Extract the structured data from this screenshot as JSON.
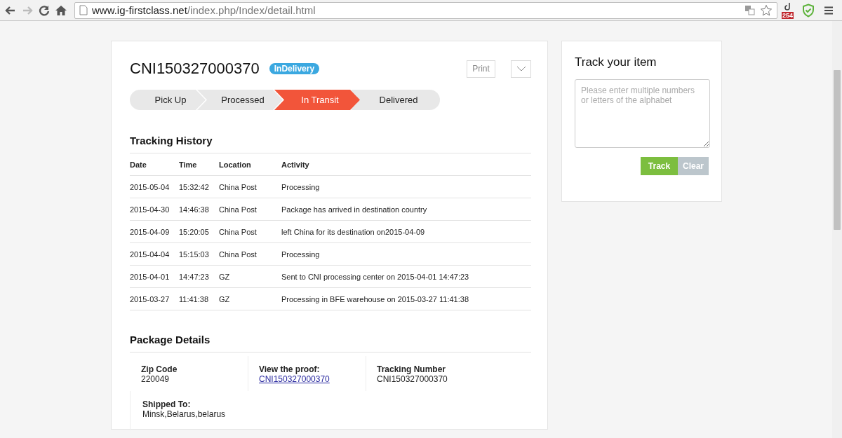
{
  "browser": {
    "url_host": "www.ig-firstclass.net",
    "url_path": "/index.php/Index/detail.html",
    "extension_badge": "254"
  },
  "shipment": {
    "number": "CNI150327000370",
    "status_badge": "InDelivery",
    "print_button": "Print"
  },
  "steps": [
    {
      "label": "Pick Up",
      "selected": false
    },
    {
      "label": "Processed",
      "selected": false
    },
    {
      "label": "In Transit",
      "selected": true
    },
    {
      "label": "Delivered",
      "selected": false
    }
  ],
  "tracking_history": {
    "title": "Tracking History",
    "columns": [
      "Date",
      "Time",
      "Location",
      "Activity"
    ],
    "rows": [
      [
        "2015-05-04",
        "15:32:42",
        "China Post",
        "Processing"
      ],
      [
        "2015-04-30",
        "14:46:38",
        "China Post",
        "Package has arrived in destination country"
      ],
      [
        "2015-04-09",
        "15:20:05",
        "China Post",
        "left China for its destination on2015-04-09"
      ],
      [
        "2015-04-04",
        "15:15:03",
        "China Post",
        "Processing"
      ],
      [
        "2015-04-01",
        "14:47:23",
        "GZ",
        "Sent to CNI processing center on 2015-04-01 14:47:23"
      ],
      [
        "2015-03-27",
        "11:41:38",
        "GZ",
        "Processing in BFE warehouse on 2015-03-27 11:41:38"
      ]
    ]
  },
  "package_details": {
    "title": "Package Details",
    "fields": [
      {
        "label": "Zip Code",
        "value": "220049",
        "kind": "text"
      },
      {
        "label": "View the proof:",
        "value": "CNI150327000370",
        "kind": "link"
      },
      {
        "label": "Tracking Number",
        "value": "CNI150327000370",
        "kind": "text"
      },
      {
        "label": "Shipped To:",
        "value": "Minsk,Belarus,belarus",
        "kind": "text"
      }
    ]
  },
  "track_panel": {
    "title": "Track your item",
    "placeholder": "Please enter multiple numbers or letters of the alphabet",
    "buttons": [
      {
        "label": "Track",
        "kind": "primary"
      },
      {
        "label": "Clear",
        "kind": "secondary"
      }
    ]
  }
}
